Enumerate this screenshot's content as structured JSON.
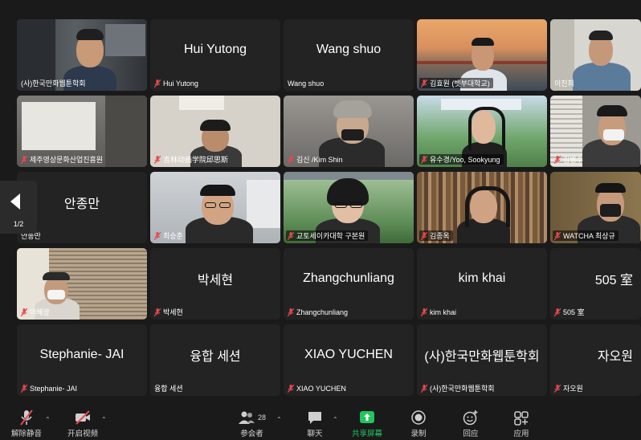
{
  "tiles": [
    {
      "label": "(사)한국만화웹툰학회",
      "center": ""
    },
    {
      "label": "Hui Yutong",
      "center": "Hui Yutong"
    },
    {
      "label": "Wang shuo",
      "center": "Wang shuo"
    },
    {
      "label": "김효원 (뱃부대학교)",
      "center": ""
    },
    {
      "label": "이진희",
      "center": ""
    },
    {
      "label": "제주영상문화산업진흥원",
      "center": ""
    },
    {
      "label": "吉林动画学院邱思斯",
      "center": ""
    },
    {
      "label": "김신 /Kim Shin",
      "center": ""
    },
    {
      "label": "유수경/Yoo, Sookyung",
      "center": ""
    },
    {
      "label": "김병수",
      "center": ""
    },
    {
      "label": "안종만",
      "center": "안종만"
    },
    {
      "label": "최승춘",
      "center": ""
    },
    {
      "label": "교토세이카대학 구본원",
      "center": ""
    },
    {
      "label": "김종옥",
      "center": ""
    },
    {
      "label": "WATCHA 최상규",
      "center": ""
    },
    {
      "label": "이혜광",
      "center": ""
    },
    {
      "label": "박세현",
      "center": "박세현"
    },
    {
      "label": "Zhangchunliang",
      "center": "Zhangchunliang"
    },
    {
      "label": "kim khai",
      "center": "kim khai"
    },
    {
      "label": "505 室",
      "center": "505 室"
    },
    {
      "label": "Stephanie- JAI",
      "center": "Stephanie- JAI"
    },
    {
      "label": "융합 세션",
      "center": "융합 세션"
    },
    {
      "label": "XIAO YUCHEN",
      "center": "XIAO YUCHEN"
    },
    {
      "label": "(사)한국만화웹툰학회",
      "center": "(사)한국만화웹툰학회"
    },
    {
      "label": "자오원",
      "center": "자오원"
    }
  ],
  "page_indicator": "1/2",
  "toolbar": {
    "unmute": "解除静音",
    "start_video": "开启视频",
    "participants": "参会者",
    "participant_count": "28",
    "chat": "聊天",
    "share": "共享屏幕",
    "record": "录制",
    "reactions": "回应",
    "apps": "应用"
  },
  "colors": {
    "active_border": "#22c55e",
    "muted_mic": "#e5484d",
    "share_green": "#22c55e"
  }
}
